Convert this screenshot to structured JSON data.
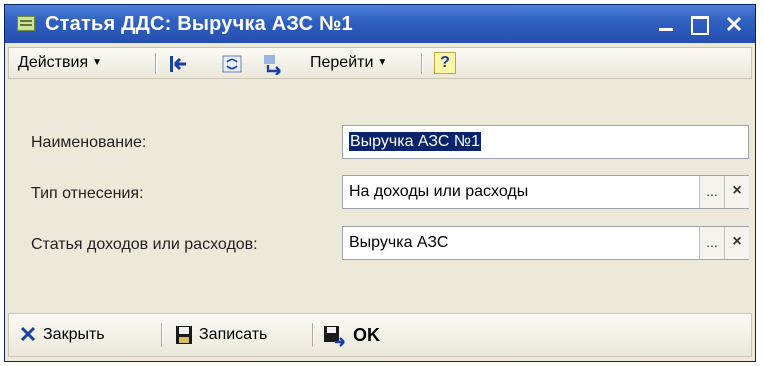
{
  "window": {
    "title": "Статья ДДС: Выручка АЗС №1",
    "title_icon": "catalog-item-icon",
    "controls": [
      "minimize-icon",
      "maximize-icon",
      "close-icon"
    ]
  },
  "toolbar": {
    "actions_label": "Действия",
    "goto_label": "Перейти",
    "help_label": "?",
    "icons": [
      "back-arrow-icon",
      "refresh-icon",
      "swap-icon",
      "help-icon"
    ]
  },
  "form": {
    "name_label": "Наименование:",
    "name_value": "Выручка АЗС №1",
    "type_label": "Тип отнесения:",
    "type_value": "На доходы или расходы",
    "article_label": "Статья доходов или расходов:",
    "article_value": "Выручка АЗС",
    "select_button": "...",
    "clear_button": "×"
  },
  "footer": {
    "close_label": "Закрыть",
    "save_label": "Записать",
    "ok_label": "OK"
  },
  "colors": {
    "titlebar": "#2f5fbf",
    "window_bg": "#ece9d8",
    "selection": "#0a246a"
  }
}
